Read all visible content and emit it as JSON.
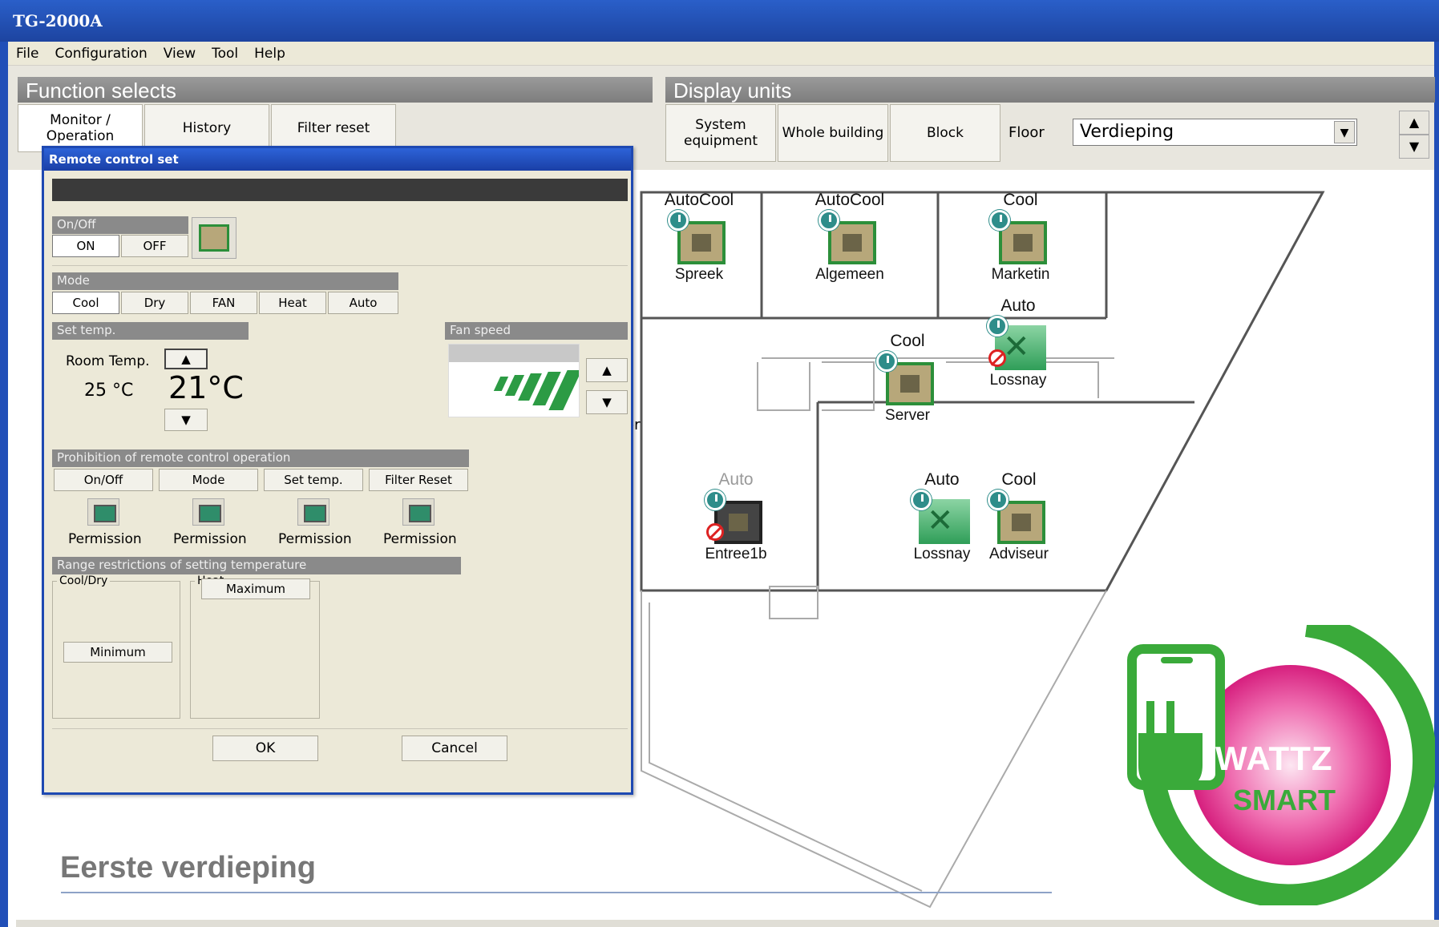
{
  "window": {
    "title": "TG-2000A"
  },
  "menu": [
    "File",
    "Configuration",
    "View",
    "Tool",
    "Help"
  ],
  "function_selects": {
    "header": "Function selects",
    "tabs": [
      "Monitor / Operation",
      "History",
      "Filter reset"
    ]
  },
  "display_units": {
    "header": "Display units",
    "tabs": [
      "System equipment",
      "Whole building",
      "Block"
    ],
    "floor_label": "Floor",
    "floor_value": "Verdieping"
  },
  "floorplan": {
    "title": "Eerste verdieping",
    "partial_text": "er",
    "units": [
      {
        "status": "AutoCool",
        "name": "Spreek",
        "type": "ac"
      },
      {
        "status": "AutoCool",
        "name": "Algemeen",
        "type": "ac"
      },
      {
        "status": "Cool",
        "name": "Marketin",
        "type": "ac"
      },
      {
        "status": "Auto",
        "name": "Lossnay",
        "type": "lossnay"
      },
      {
        "status": "Cool",
        "name": "Server",
        "type": "ac"
      },
      {
        "status": "Auto",
        "name": "Entree1b",
        "type": "ac-off"
      },
      {
        "status": "Auto",
        "name": "Lossnay",
        "type": "lossnay"
      },
      {
        "status": "Cool",
        "name": "Adviseur",
        "type": "ac"
      }
    ]
  },
  "dialog": {
    "title": "Remote control set",
    "onoff_group": "On/Off",
    "on": "ON",
    "off": "OFF",
    "mode_group": "Mode",
    "modes": [
      "Cool",
      "Dry",
      "FAN",
      "Heat",
      "Auto"
    ],
    "set_temp_group": "Set temp.",
    "room_temp_label": "Room Temp.",
    "room_temp_value": "25 °C",
    "set_temp_value": "21°C",
    "fan_speed_group": "Fan speed",
    "prohibition_group": "Prohibition of remote control operation",
    "prohibition_items": [
      {
        "label": "On/Off",
        "state": "Permission"
      },
      {
        "label": "Mode",
        "state": "Permission"
      },
      {
        "label": "Set temp.",
        "state": "Permission"
      },
      {
        "label": "Filter Reset",
        "state": "Permission"
      }
    ],
    "range_group": "Range restrictions of setting temperature",
    "cooldry_label": "Cool/Dry",
    "heat_label": "Heat",
    "minimum_btn": "Minimum",
    "maximum_btn": "Maximum",
    "ok": "OK",
    "cancel": "Cancel"
  },
  "logo": {
    "line1": "WATTZ",
    "line2": "SMART"
  },
  "colors": {
    "titlebar": "#1d44a0",
    "accent_green": "#3aaa3a",
    "logo_pink": "#e6338c"
  }
}
